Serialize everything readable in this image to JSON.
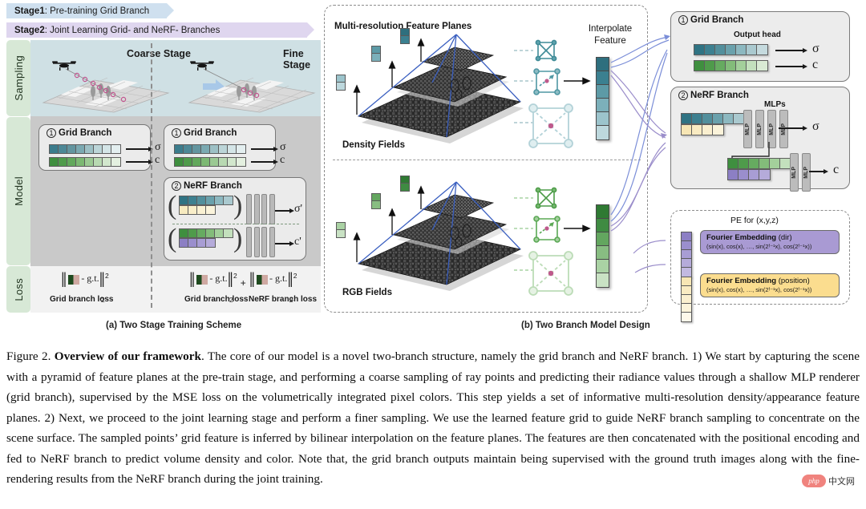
{
  "stages": [
    {
      "label": "Stage1",
      "text": ": Pre-training Grid Branch",
      "color": "#cfe0ef"
    },
    {
      "label": "Stage2",
      "text": ": Joint Learning Grid- and NeRF- Branches",
      "color": "#dfd6ef"
    }
  ],
  "panel_a": {
    "row_labels": [
      "Sampling",
      "Model",
      "Loss"
    ],
    "stage_names": [
      "Coarse Stage",
      "Fine Stage"
    ],
    "grid_branch": {
      "num": "1",
      "title": "Grid Branch",
      "out_sigma": "σ",
      "out_color": "c",
      "vec_density_colors": [
        "#3b7c8c",
        "#4d8896",
        "#63959f",
        "#7ba9b1",
        "#9dc0c5",
        "#bcd5d8",
        "#d4e5e7",
        "#e3eeef"
      ],
      "vec_color_colors": [
        "#3f8f3f",
        "#4f9b4b",
        "#62a85c",
        "#7cb873",
        "#9bc993",
        "#b8d9b2",
        "#d2e7cd",
        "#e4f0e0"
      ]
    },
    "nerf_branch": {
      "num": "2",
      "title": "NeRF Branch",
      "out_sigma": "σ'",
      "out_color": "c'",
      "grid_density_colors": [
        "#2f7383",
        "#3d8090",
        "#528f9c",
        "#6aa1ac",
        "#8cb8c0",
        "#aac9cf"
      ],
      "pe_position_colors": [
        "#f7ebc0",
        "#f9eec9",
        "#faf1d3",
        "#fbf4dc"
      ],
      "grid_rgb_colors": [
        "#3f8f3f",
        "#4f9b4b",
        "#66ab60",
        "#83bc7a",
        "#a3cf9b",
        "#c3e0bd"
      ],
      "pe_dir_colors": [
        "#8c7fc4",
        "#9a8ecd",
        "#a89dd4",
        "#b5abda"
      ]
    },
    "loss": {
      "gt_text": "- g.t.",
      "sup": "2",
      "sub": "2",
      "plus": "+",
      "captions_stage1": [
        "Grid branch loss"
      ],
      "captions_stage2": [
        "Grid branch loss",
        "NeRF branch loss"
      ]
    },
    "subcaption": "(a) Two Stage Training Scheme"
  },
  "panel_b": {
    "header": "Multi-resolution Feature Planes",
    "density_title": "Density Fields",
    "rgb_title": "RGB Fields",
    "interpolate_label_line1": "Interpolate",
    "interpolate_label_line2": "Feature",
    "density_feature_colors": [
      "#2e6f7e",
      "#3b8090",
      "#5d9aa6",
      "#7cb0ba",
      "#9cc4cc",
      "#bdd8dd"
    ],
    "rgb_feature_colors": [
      "#2f7a33",
      "#3f8b42",
      "#63a65f",
      "#88bd82",
      "#aad2a4",
      "#c9e2c4"
    ],
    "subcaption": "(b) Two Branch Model Design"
  },
  "panel_c": {
    "grid_branch": {
      "num": "1",
      "title": "Grid Branch",
      "output_head_label": "Output head",
      "out_sigma": "σ",
      "out_color": "c",
      "density_colors": [
        "#2f7383",
        "#3d8090",
        "#528f9c",
        "#6aa1ac",
        "#8cb8c0",
        "#aac9cf",
        "#c5dade"
      ],
      "color_colors": [
        "#3f8f3f",
        "#4f9b4b",
        "#66ab60",
        "#83bc7a",
        "#a3cf9b",
        "#c3e0bd",
        "#d9ead4"
      ]
    },
    "nerf_branch": {
      "num": "2",
      "title": "NeRF Branch",
      "mlps_label": "MLPs",
      "mlp_label": "MLP",
      "out_sigma": "σ",
      "out_color": "c",
      "density_colors": [
        "#2f7383",
        "#3d8090",
        "#528f9c",
        "#6aa1ac",
        "#8cb8c0",
        "#aac9cf"
      ],
      "pe_position_colors": [
        "#f7e6b4",
        "#f9ebc2",
        "#faefcf",
        "#fbf3da"
      ],
      "rgb_colors": [
        "#3f8f3f",
        "#4f9b4b",
        "#66ab60",
        "#83bc7a",
        "#a3cf9b",
        "#c3e0bd"
      ],
      "pe_dir_colors": [
        "#8c7fc4",
        "#9a8ecd",
        "#a89dd4",
        "#b5abda"
      ]
    },
    "pe": {
      "title": "PE for (x,y,z)",
      "dir": {
        "title_bold": "Fourier Embedding",
        "title_rest": " (dir)",
        "formula": "(sin(x), cos(x), …, sin(2ᶠ⁻¹x), cos(2ᶠ⁻¹x))",
        "fill": "#a99ad3",
        "vec_colors": [
          "#8c7fc4",
          "#9a8ecd",
          "#a89dd4",
          "#b5abda",
          "#c2b9e1"
        ]
      },
      "position": {
        "title_bold": "Fourier Embedding",
        "title_rest": " (position)",
        "formula": "(sin(x), cos(x), …, sin(2ᶠ⁻¹x), cos(2ᶠ⁻¹x))",
        "fill": "#fbdd8f",
        "vec_colors": [
          "#f7e6b4",
          "#f9ebc2",
          "#faefcf",
          "#fbf3da",
          "#fdf8ea"
        ]
      }
    }
  },
  "caption": {
    "figure_no": "Figure 2. ",
    "bold_title": "Overview of our framework",
    "body": ". The core of our model is a novel two-branch structure, namely the grid branch and NeRF branch. 1) We start by capturing the scene with a pyramid of feature planes at the pre-train stage, and performing a coarse sampling of ray points and predicting their radiance values through a shallow MLP renderer (grid branch), supervised by the MSE loss on the volumetrically integrated pixel colors. This step yields a set of informative multi-resolution density/appearance feature planes. 2) Next, we proceed to the joint learning stage and perform a finer sampling. We use the learned feature grid to guide NeRF branch sampling to concentrate on the scene surface. The sampled points’ grid feature is inferred by bilinear interpolation on the feature planes. The features are then concatenated with the positional encoding and fed to NeRF branch to predict volume density and color. Note that, the grid branch outputs maintain being supervised with the ground truth images along with the fine-rendering results from the NeRF branch during the joint training."
  },
  "watermark": {
    "badge": "php",
    "text": "中文网"
  }
}
